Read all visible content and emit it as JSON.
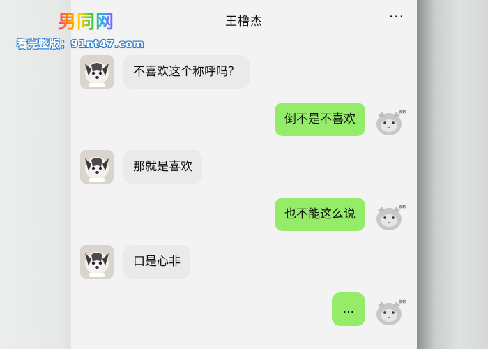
{
  "watermark": {
    "logo": "男同网",
    "url": "看完整版：91nt47.com"
  },
  "header": {
    "title": "王橹杰",
    "more_label": "···"
  },
  "messages": [
    {
      "side": "left",
      "text": "不喜欢这个称呼吗？"
    },
    {
      "side": "right",
      "text": "倒不是不喜欢"
    },
    {
      "side": "left",
      "text": "那就是喜欢"
    },
    {
      "side": "right",
      "text": "也不能这么说"
    },
    {
      "side": "left",
      "text": "口是心非"
    },
    {
      "side": "right",
      "text": "..."
    }
  ],
  "avatar_sticker_text": "收到",
  "colors": {
    "left_bubble": "#eaeaea",
    "right_bubble": "#95ec69",
    "chat_bg": "#f3f3f3"
  }
}
